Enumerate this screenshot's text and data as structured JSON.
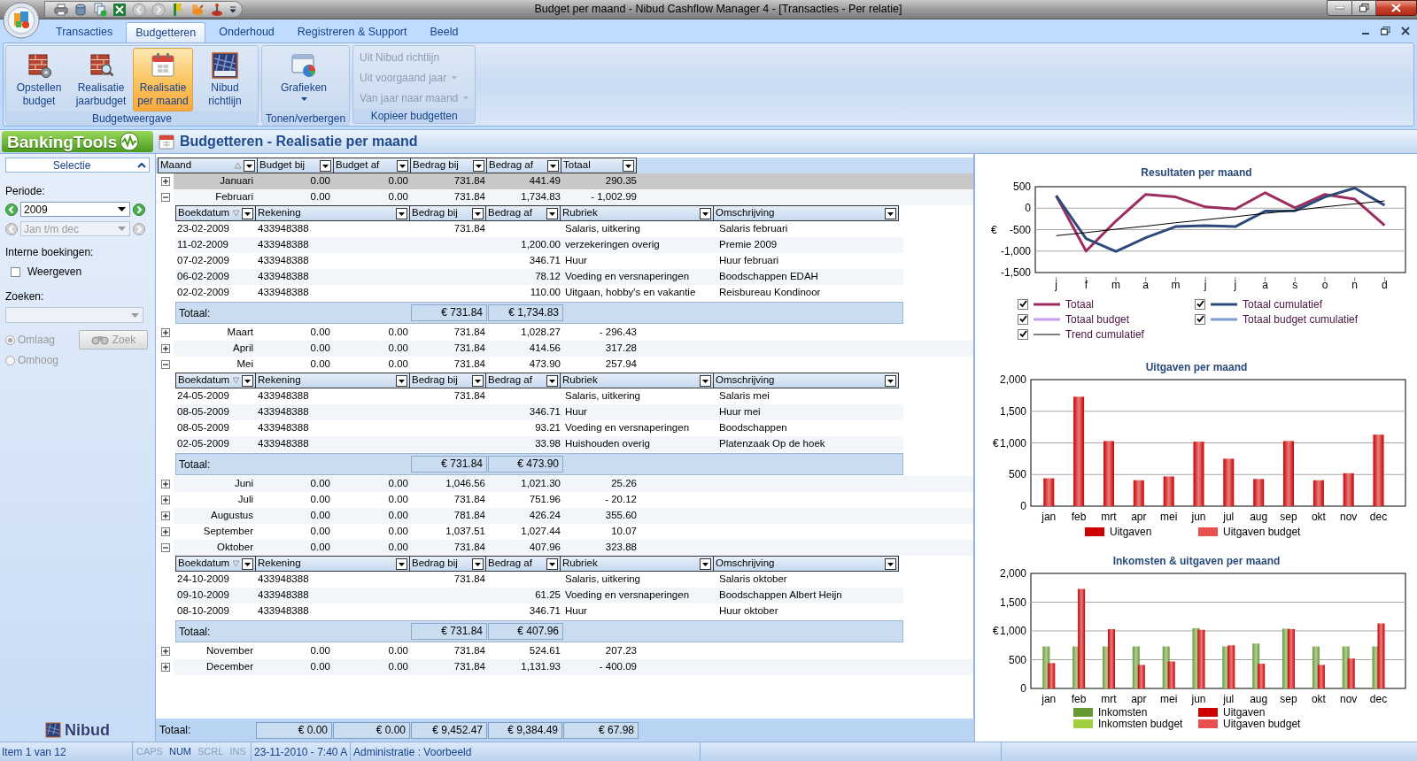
{
  "window": {
    "title": "Budget per maand - Nibud Cashflow Manager 4 - [Transacties - Per relatie]"
  },
  "ribbon": {
    "tabs": [
      {
        "label": "Transacties",
        "selected": false
      },
      {
        "label": "Budgetteren",
        "selected": true
      },
      {
        "label": "Onderhoud",
        "selected": false
      },
      {
        "label": "Registreren & Support",
        "selected": false
      },
      {
        "label": "Beeld",
        "selected": false
      }
    ],
    "groups": [
      {
        "label": "Budgetweergave",
        "kind": "large",
        "buttons": [
          {
            "label": "Opstellen budget",
            "selected": false,
            "dropdown": false
          },
          {
            "label": "Realisatie jaarbudget",
            "selected": false,
            "dropdown": false
          },
          {
            "label": "Realisatie per maand",
            "selected": true,
            "dropdown": false
          },
          {
            "label": "Nibud richtlijn",
            "selected": false,
            "dropdown": false
          }
        ]
      },
      {
        "label": "Tonen/verbergen",
        "kind": "large",
        "buttons": [
          {
            "label": "Grafieken",
            "selected": false,
            "dropdown": true
          }
        ]
      },
      {
        "label": "Kopieer budgetten",
        "kind": "small",
        "buttons": [
          {
            "label": "Uit Nibud richtlijn",
            "disabled": true,
            "dropdown": false
          },
          {
            "label": "Uit voorgaand jaar",
            "disabled": true,
            "dropdown": true
          },
          {
            "label": "Van jaar naar maand",
            "disabled": true,
            "dropdown": true
          }
        ]
      }
    ]
  },
  "header": {
    "brand": "BankingTools",
    "page_title": "Budgetteren - Realisatie per maand"
  },
  "sidebar": {
    "section": "Selectie",
    "expanded": true,
    "periode_label": "Periode:",
    "year": "2009",
    "range": {
      "value": "Jan t/m dec",
      "disabled": true
    },
    "interne_label": "Interne boekingen:",
    "weergeven": {
      "label": "Weergeven",
      "checked": false
    },
    "zoeken_label": "Zoeken:",
    "search": {
      "disabled": true
    },
    "direction_disabled": true,
    "direction": [
      {
        "label": "Omlaag",
        "selected": true
      },
      {
        "label": "Omhoog",
        "selected": false
      }
    ],
    "search_button": {
      "label": "Zoek",
      "disabled": true
    },
    "logo": "Nibud"
  },
  "grid": {
    "columns": [
      {
        "label": "Maand",
        "sorted": true,
        "descending": false
      },
      {
        "label": "Budget bij",
        "sorted": false
      },
      {
        "label": "Budget af",
        "sorted": false
      },
      {
        "label": "Bedrag bij",
        "sorted": false
      },
      {
        "label": "Bedrag af",
        "sorted": false
      },
      {
        "label": "Totaal",
        "sorted": false
      }
    ],
    "rows": [
      {
        "maand": "Januari",
        "budget_bij": "0.00",
        "budget_af": "0.00",
        "bedrag_bij": "731.84",
        "bedrag_af": "441.49",
        "totaal": "290.35",
        "expanded": false,
        "selected": true
      },
      {
        "maand": "Februari",
        "budget_bij": "0.00",
        "budget_af": "0.00",
        "bedrag_bij": "731.84",
        "bedrag_af": "1,734.83",
        "totaal": "- 1,002.99",
        "expanded": true,
        "selected": false,
        "detail": {
          "columns": [
            {
              "label": "Boekdatum",
              "sorted": true,
              "descending": true
            },
            {
              "label": "Rekening",
              "sorted": false
            },
            {
              "label": "Bedrag bij",
              "sorted": false
            },
            {
              "label": "Bedrag af",
              "sorted": false
            },
            {
              "label": "Rubriek",
              "sorted": false
            },
            {
              "label": "Omschrijving",
              "sorted": false
            }
          ],
          "rows": [
            {
              "boekdatum": "23-02-2009",
              "rekening": "433948388",
              "bedrag_bij": "731.84",
              "rubriek": "Salaris, uitkering",
              "omschrijving": "Salaris februari"
            },
            {
              "boekdatum": "11-02-2009",
              "rekening": "433948388",
              "bedrag_af": "1,200.00",
              "rubriek": "verzekeringen overig",
              "omschrijving": "Premie 2009"
            },
            {
              "boekdatum": "07-02-2009",
              "rekening": "433948388",
              "bedrag_af": "346.71",
              "rubriek": "Huur",
              "omschrijving": "Huur februari"
            },
            {
              "boekdatum": "06-02-2009",
              "rekening": "433948388",
              "bedrag_af": "78.12",
              "rubriek": "Voeding en versnaperingen",
              "omschrijving": "Boodschappen EDAH"
            },
            {
              "boekdatum": "02-02-2009",
              "rekening": "433948388",
              "bedrag_af": "110.00",
              "rubriek": "Uitgaan, hobby's en vakantie",
              "omschrijving": "Reisbureau Kondinoor"
            }
          ],
          "total": {
            "label": "Totaal:",
            "bedrag_bij": "€ 731.84",
            "bedrag_af": "€ 1,734.83"
          }
        }
      },
      {
        "maand": "Maart",
        "budget_bij": "0.00",
        "budget_af": "0.00",
        "bedrag_bij": "731.84",
        "bedrag_af": "1,028.27",
        "totaal": "- 296.43",
        "expanded": false,
        "selected": false
      },
      {
        "maand": "April",
        "budget_bij": "0.00",
        "budget_af": "0.00",
        "bedrag_bij": "731.84",
        "bedrag_af": "414.56",
        "totaal": "317.28",
        "expanded": false,
        "selected": false
      },
      {
        "maand": "Mei",
        "budget_bij": "0.00",
        "budget_af": "0.00",
        "bedrag_bij": "731.84",
        "bedrag_af": "473.90",
        "totaal": "257.94",
        "expanded": true,
        "selected": false,
        "detail": {
          "columns": [
            {
              "label": "Boekdatum",
              "sorted": true,
              "descending": true
            },
            {
              "label": "Rekening",
              "sorted": false
            },
            {
              "label": "Bedrag bij",
              "sorted": false
            },
            {
              "label": "Bedrag af",
              "sorted": false
            },
            {
              "label": "Rubriek",
              "sorted": false
            },
            {
              "label": "Omschrijving",
              "sorted": false
            }
          ],
          "rows": [
            {
              "boekdatum": "24-05-2009",
              "rekening": "433948388",
              "bedrag_bij": "731.84",
              "rubriek": "Salaris, uitkering",
              "omschrijving": "Salaris mei"
            },
            {
              "boekdatum": "08-05-2009",
              "rekening": "433948388",
              "bedrag_af": "346.71",
              "rubriek": "Huur",
              "omschrijving": "Huur mei"
            },
            {
              "boekdatum": "08-05-2009",
              "rekening": "433948388",
              "bedrag_af": "93.21",
              "rubriek": "Voeding en versnaperingen",
              "omschrijving": "Boodschappen"
            },
            {
              "boekdatum": "02-05-2009",
              "rekening": "433948388",
              "bedrag_af": "33.98",
              "rubriek": "Huishouden overig",
              "omschrijving": "Platenzaak Op de hoek"
            }
          ],
          "total": {
            "label": "Totaal:",
            "bedrag_bij": "€ 731.84",
            "bedrag_af": "€ 473.90"
          }
        }
      },
      {
        "maand": "Juni",
        "budget_bij": "0.00",
        "budget_af": "0.00",
        "bedrag_bij": "1,046.56",
        "bedrag_af": "1,021.30",
        "totaal": "25.26",
        "expanded": false,
        "selected": false
      },
      {
        "maand": "Juli",
        "budget_bij": "0.00",
        "budget_af": "0.00",
        "bedrag_bij": "731.84",
        "bedrag_af": "751.96",
        "totaal": "- 20.12",
        "expanded": false,
        "selected": false
      },
      {
        "maand": "Augustus",
        "budget_bij": "0.00",
        "budget_af": "0.00",
        "bedrag_bij": "781.84",
        "bedrag_af": "426.24",
        "totaal": "355.60",
        "expanded": false,
        "selected": false
      },
      {
        "maand": "September",
        "budget_bij": "0.00",
        "budget_af": "0.00",
        "bedrag_bij": "1,037.51",
        "bedrag_af": "1,027.44",
        "totaal": "10.07",
        "expanded": false,
        "selected": false
      },
      {
        "maand": "Oktober",
        "budget_bij": "0.00",
        "budget_af": "0.00",
        "bedrag_bij": "731.84",
        "bedrag_af": "407.96",
        "totaal": "323.88",
        "expanded": true,
        "selected": false,
        "detail": {
          "columns": [
            {
              "label": "Boekdatum",
              "sorted": true,
              "descending": true
            },
            {
              "label": "Rekening",
              "sorted": false
            },
            {
              "label": "Bedrag bij",
              "sorted": false
            },
            {
              "label": "Bedrag af",
              "sorted": false
            },
            {
              "label": "Rubriek",
              "sorted": false
            },
            {
              "label": "Omschrijving",
              "sorted": false
            }
          ],
          "rows": [
            {
              "boekdatum": "24-10-2009",
              "rekening": "433948388",
              "bedrag_bij": "731.84",
              "rubriek": "Salaris, uitkering",
              "omschrijving": "Salaris oktober"
            },
            {
              "boekdatum": "09-10-2009",
              "rekening": "433948388",
              "bedrag_af": "61.25",
              "rubriek": "Voeding en versnaperingen",
              "omschrijving": "Boodschappen Albert Heijn"
            },
            {
              "boekdatum": "08-10-2009",
              "rekening": "433948388",
              "bedrag_af": "346.71",
              "rubriek": "Huur",
              "omschrijving": "Huur oktober"
            }
          ],
          "total": {
            "label": "Totaal:",
            "bedrag_bij": "€ 731.84",
            "bedrag_af": "€ 407.96"
          }
        }
      },
      {
        "maand": "November",
        "budget_bij": "0.00",
        "budget_af": "0.00",
        "bedrag_bij": "731.84",
        "bedrag_af": "524.61",
        "totaal": "207.23",
        "expanded": false,
        "selected": false
      },
      {
        "maand": "December",
        "budget_bij": "0.00",
        "budget_af": "0.00",
        "bedrag_bij": "731.84",
        "bedrag_af": "1,131.93",
        "totaal": "- 400.09",
        "expanded": false,
        "selected": false
      }
    ],
    "totals": {
      "label": "Totaal:",
      "values": [
        "€ 0.00",
        "€ 0.00",
        "€ 9,452.47",
        "€ 9,384.49",
        "€ 67.98"
      ]
    }
  },
  "charts": [
    {
      "chart_data": {
        "type": "line",
        "title": "Resultaten per maand",
        "ylabel": "€",
        "categories": [
          "j",
          "f",
          "m",
          "a",
          "m",
          "j",
          "j",
          "a",
          "s",
          "o",
          "n",
          "d"
        ],
        "ylim": [
          -1500,
          500
        ],
        "yticks": [
          500,
          0,
          -500,
          {
            "value": -1000,
            "label": "-1,000"
          },
          {
            "value": -1500,
            "label": "-1,500"
          }
        ],
        "grid": true,
        "legend": true,
        "series": [
          {
            "name": "Totaal",
            "color": "#9b2d5f",
            "values": [
              290,
              -1000,
              -300,
              320,
              260,
              30,
              -20,
              360,
              10,
              320,
              210,
              -400
            ]
          },
          {
            "name": "Totaal cumulatief",
            "color": "#2e4a7a",
            "values": [
              290,
              -710,
              -1010,
              -690,
              -430,
              -410,
              -430,
              -70,
              -60,
              260,
              470,
              70
            ]
          },
          {
            "name": "Totaal budget",
            "color": "#c89cf0",
            "values": [
              null,
              null,
              null,
              null,
              null,
              null,
              null,
              null,
              null,
              null,
              null,
              null
            ]
          },
          {
            "name": "Totaal budget cumulatief",
            "color": "#7f9bd0",
            "values": [
              null,
              null,
              null,
              null,
              null,
              null,
              null,
              null,
              null,
              null,
              null,
              null
            ]
          },
          {
            "name": "Trend cumulatief",
            "color": "#000000",
            "values": [
              -640,
              -570,
              -490,
              -420,
              -340,
              -270,
              -200,
              -120,
              -50,
              30,
              100,
              170
            ]
          }
        ]
      },
      "series_meta": [
        {
          "kind": "line",
          "checked": true
        },
        {
          "kind": "line",
          "checked": true
        },
        {
          "kind": "line",
          "checked": true
        },
        {
          "kind": "line",
          "checked": true
        },
        {
          "kind": "trend",
          "checked": true
        }
      ]
    },
    {
      "chart_data": {
        "type": "bar",
        "title": "Uitgaven per maand",
        "ylabel": "€",
        "categories": [
          "jan",
          "feb",
          "mrt",
          "apr",
          "mei",
          "jun",
          "jul",
          "aug",
          "sep",
          "okt",
          "nov",
          "dec"
        ],
        "ylim": [
          0,
          2000
        ],
        "yticks": [
          0,
          500,
          {
            "value": 1000,
            "label": "1,000"
          },
          {
            "value": 1500,
            "label": "1,500"
          },
          {
            "value": 2000,
            "label": "2,000"
          }
        ],
        "grid": true,
        "legend": true,
        "series": [
          {
            "name": "Uitgaven",
            "color": "#cc0000",
            "values": [
              440,
              1730,
              1030,
              410,
              470,
              1020,
              750,
              430,
              1030,
              410,
              520,
              1130
            ]
          },
          {
            "name": "Uitgaven budget",
            "color": "#e85050",
            "values": [
              0,
              0,
              0,
              0,
              0,
              0,
              0,
              0,
              0,
              0,
              0,
              0
            ]
          }
        ]
      },
      "series_meta": [
        {
          "kind": "actual"
        },
        {
          "kind": "budget"
        }
      ]
    },
    {
      "chart_data": {
        "type": "bar",
        "title": "Inkomsten & uitgaven per maand",
        "ylabel": "€",
        "categories": [
          "jan",
          "feb",
          "mrt",
          "apr",
          "mei",
          "jun",
          "jul",
          "aug",
          "sep",
          "okt",
          "nov",
          "dec"
        ],
        "ylim": [
          0,
          2000
        ],
        "yticks": [
          0,
          500,
          {
            "value": 1000,
            "label": "1,000"
          },
          {
            "value": 1500,
            "label": "1,500"
          },
          {
            "value": 2000,
            "label": "2,000"
          }
        ],
        "grid": true,
        "legend": true,
        "series": [
          {
            "name": "Inkomsten",
            "color": "#669933",
            "values": [
              730,
              730,
              730,
              730,
              730,
              1050,
              730,
              780,
              1040,
              730,
              730,
              730
            ]
          },
          {
            "name": "Uitgaven",
            "color": "#cc0000",
            "values": [
              440,
              1730,
              1030,
              410,
              470,
              1020,
              750,
              430,
              1030,
              410,
              520,
              1130
            ]
          },
          {
            "name": "Inkomsten budget",
            "color": "#a0d040",
            "values": [
              0,
              0,
              0,
              0,
              0,
              0,
              0,
              0,
              0,
              0,
              0,
              0
            ]
          },
          {
            "name": "Uitgaven budget",
            "color": "#e85050",
            "values": [
              0,
              0,
              0,
              0,
              0,
              0,
              0,
              0,
              0,
              0,
              0,
              0
            ]
          }
        ]
      },
      "series_meta": [
        {
          "kind": "actual"
        },
        {
          "kind": "actual"
        },
        {
          "kind": "budget"
        },
        {
          "kind": "budget"
        }
      ]
    }
  ],
  "status_bar": {
    "item": "Item 1 van 12",
    "keys": [
      {
        "label": "CAPS",
        "on": false
      },
      {
        "label": "NUM",
        "on": true
      },
      {
        "label": "SCRL",
        "on": false
      },
      {
        "label": "INS",
        "on": false
      }
    ],
    "datetime": "23-11-2010 - 7:40 A",
    "administratie": "Administratie : Voorbeeld"
  }
}
